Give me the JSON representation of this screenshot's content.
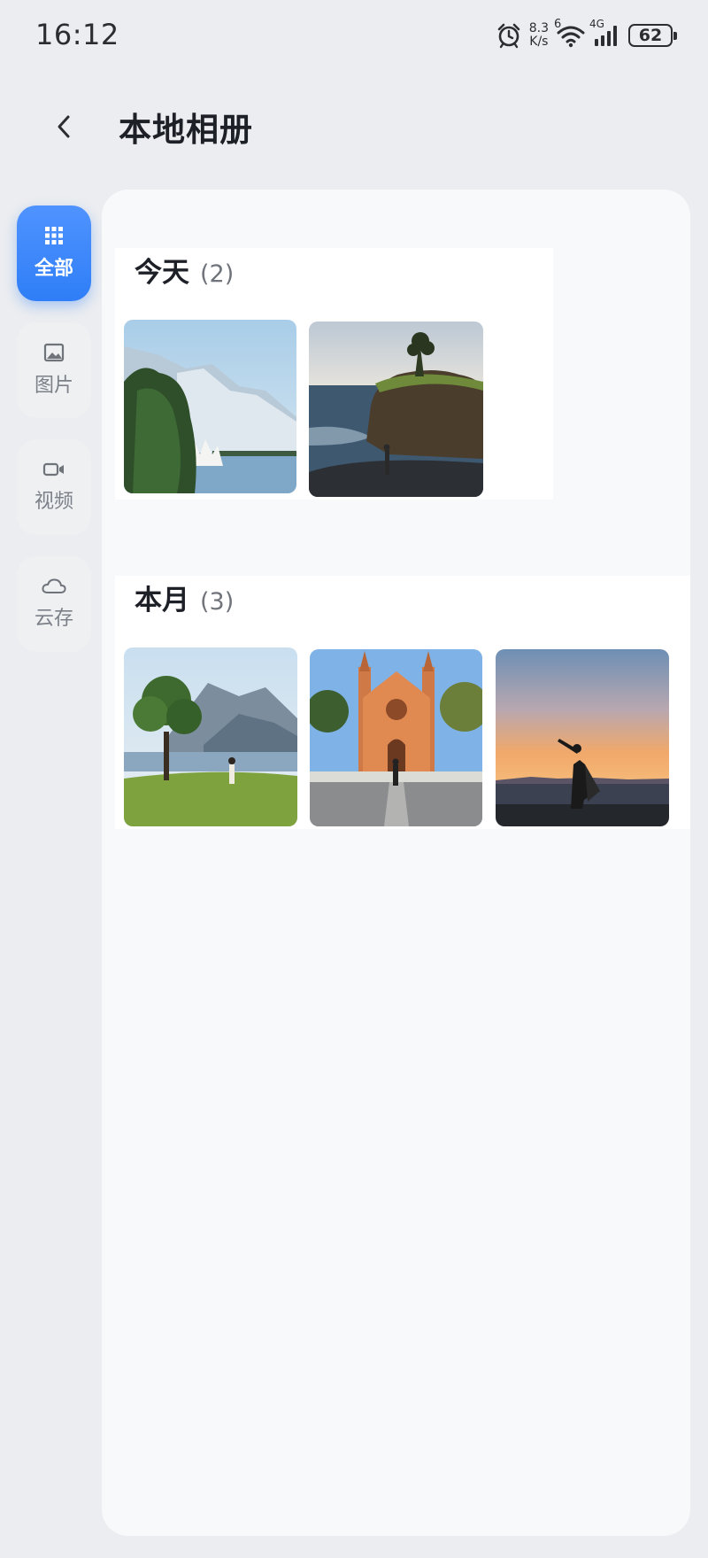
{
  "status_bar": {
    "time": "16:12",
    "net_speed_value": "8.3",
    "net_speed_unit": "K/s",
    "wifi_badge": "6",
    "cell_badge": "4G",
    "battery": "62",
    "icons": [
      "alarm-icon",
      "wifi-icon",
      "cell-signal-icon",
      "battery-icon"
    ]
  },
  "header": {
    "back_icon": "chevron-left-icon",
    "title": "本地相册"
  },
  "sidebar": {
    "items": [
      {
        "label": "全部",
        "icon": "grid-icon",
        "active": true
      },
      {
        "label": "图片",
        "icon": "image-icon",
        "active": false
      },
      {
        "label": "视频",
        "icon": "video-icon",
        "active": false
      },
      {
        "label": "云存",
        "icon": "cloud-icon",
        "active": false
      }
    ]
  },
  "sections": [
    {
      "title": "今天",
      "count": "(2)",
      "photos": [
        "lake-mountain-opera-house-photo",
        "coastal-cliff-photo"
      ]
    },
    {
      "title": "本月",
      "count": "(3)",
      "photos": [
        "lakeside-meadow-photo",
        "orange-church-photo",
        "sunset-silhouette-photo"
      ]
    }
  ],
  "colors": {
    "accent": "#3a86fa",
    "page_bg": "#ebedf0",
    "card_bg": "#f8f9fa"
  }
}
